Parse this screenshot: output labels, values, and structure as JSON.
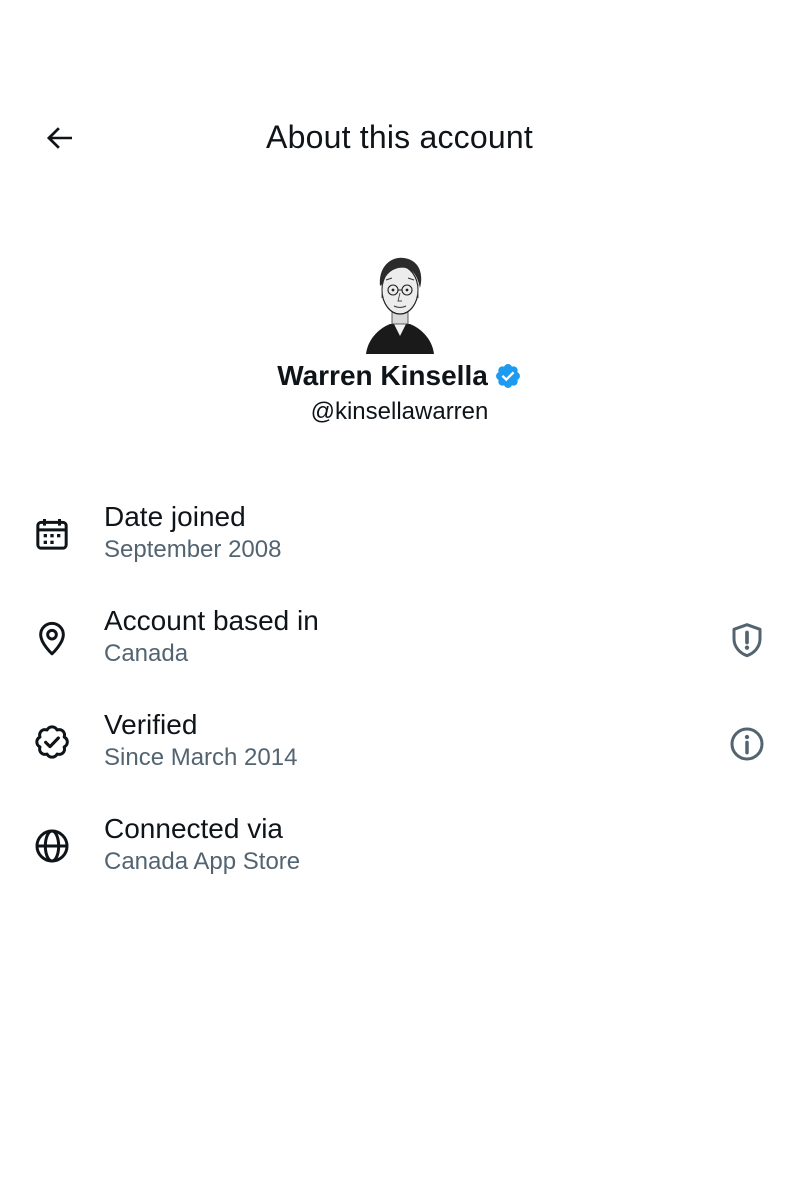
{
  "header": {
    "title": "About this account",
    "back_icon": "arrow-left-icon"
  },
  "profile": {
    "name": "Warren Kinsella",
    "handle": "@kinsellawarren",
    "verified": true,
    "badge_color": "#1d9bf0",
    "avatar_icon": "avatar-sketch-portrait"
  },
  "info_rows": [
    {
      "icon": "calendar-icon",
      "label": "Date joined",
      "value": "September 2008",
      "action": null
    },
    {
      "icon": "location-pin-icon",
      "label": "Account based in",
      "value": "Canada",
      "action": "shield-alert-icon"
    },
    {
      "icon": "verified-check-icon",
      "label": "Verified",
      "value": "Since March 2014",
      "action": "info-icon"
    },
    {
      "icon": "globe-icon",
      "label": "Connected via",
      "value": "Canada App Store",
      "action": null
    }
  ],
  "colors": {
    "text_primary": "#0f1419",
    "text_secondary": "#536471",
    "background": "#ffffff"
  }
}
